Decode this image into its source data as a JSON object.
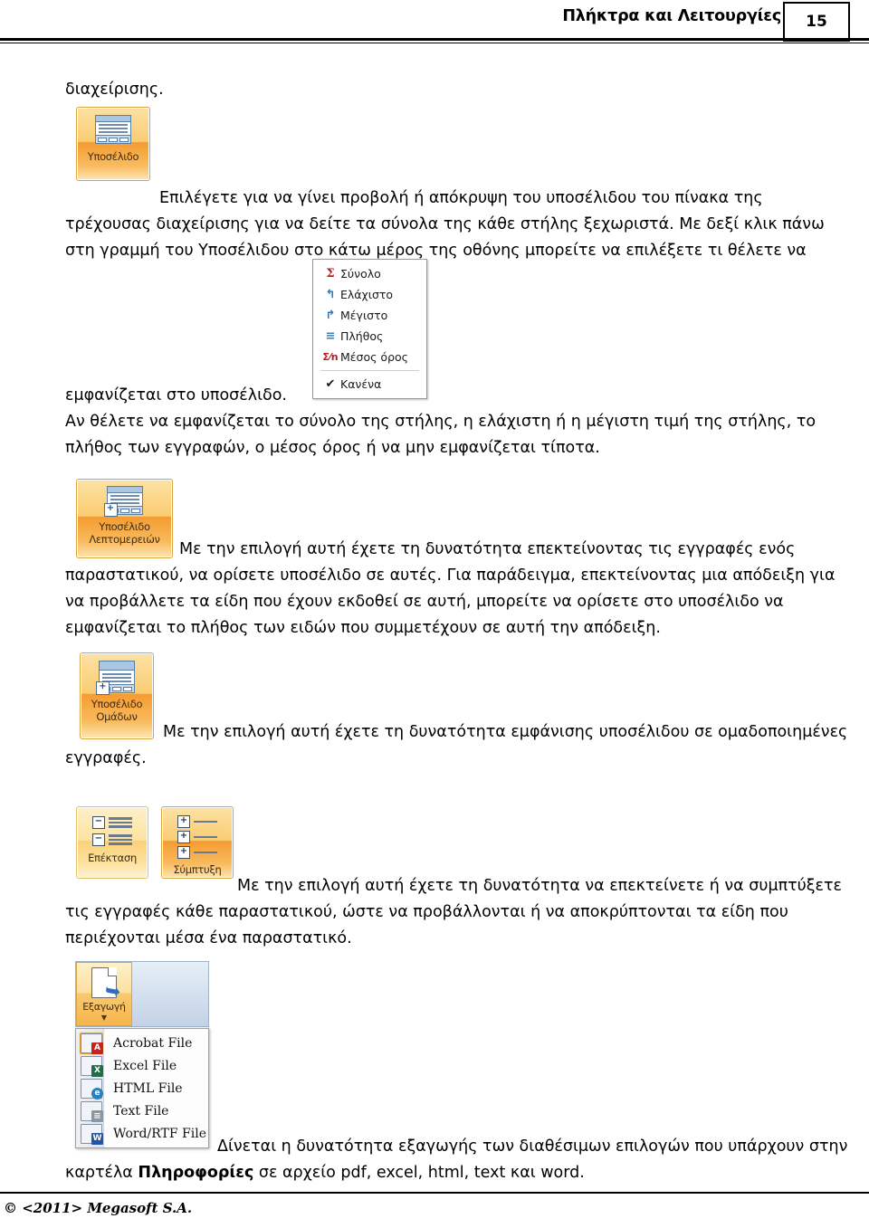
{
  "header": {
    "title": "Πλήκτρα και Λειτουργίες",
    "page_number": "15"
  },
  "footer": {
    "copyright": "© <2011> Megasoft S.A."
  },
  "body": {
    "lead_word": "διαχείρισης.",
    "para1": "Επιλέγετε για να γίνει προβολή ή απόκρυψη του υποσέλιδου του πίνακα της τρέχουσας διαχείρισης για να δείτε τα σύνολα της κάθε στήλης ξεχωριστά. Με δεξί κλικ πάνω στη γραμμή του Υποσέλιδου στο κάτω μέρος της οθόνης μπορείτε να επιλέξετε τι θέλετε να",
    "para2_line1": "εμφανίζεται στο υποσέλιδο.",
    "para2_rest": "Αν θέλετε να εμφανίζεται το σύνολο της στήλης, η ελάχιστη ή η μέγιστη τιμή της στήλης, το πλήθος των εγγραφών, ο μέσος όρος ή να μην εμφανίζεται τίποτα.",
    "para3": "Με την επιλογή αυτή έχετε τη δυνατότητα επεκτείνοντας τις εγγραφές ενός παραστατικού, να ορίσετε υποσέλιδο σε αυτές. Για παράδειγμα, επεκτείνοντας μια απόδειξη για να προβάλλετε τα είδη που έχουν εκδοθεί σε αυτή, μπορείτε να ορίσετε στο υποσέλιδο να εμφανίζεται το πλήθος των ειδών που συμμετέχουν σε αυτή την απόδειξη.",
    "para4": "Με την επιλογή αυτή έχετε τη δυνατότητα εμφάνισης υποσέλιδου σε ομαδοποιημένες εγγραφές.",
    "para5": "Με την επιλογή αυτή έχετε τη δυνατότητα να επεκτείνετε ή να συμπτύξετε τις εγγραφές κάθε παραστατικού, ώστε να προβάλλονται ή να αποκρύπτονται τα είδη που περιέχονται μέσα ένα παραστατικό.",
    "para6_a": "Δίνεται η δυνατότητα εξαγωγής των διαθέσιμων επιλογών που υπάρχουν στην καρτέλα ",
    "para6_bold": "Πληροφορίες",
    "para6_b": " σε αρχείο pdf, excel,  html, text και word."
  },
  "buttons": {
    "footer_button": {
      "label": "Υποσέλιδο",
      "icon": "window-footer-icon"
    },
    "detail_footer_button": {
      "label_line1": "Υποσέλιδο",
      "label_line2": "Λεπτομερειών",
      "icon": "window-footer-plus-icon"
    },
    "group_footer_button": {
      "label_line1": "Υποσέλιδο",
      "label_line2": "Ομάδων",
      "icon": "window-group-footer-icon"
    },
    "expand_button": {
      "label": "Επέκταση",
      "icon": "expand-list-icon",
      "sign": "−"
    },
    "collapse_button": {
      "label": "Σύμπτυξη",
      "icon": "collapse-list-icon",
      "sign": "+"
    },
    "export_button": {
      "label": "Εξαγωγή",
      "icon": "export-document-icon",
      "caret": "▼"
    }
  },
  "stats_menu": {
    "items": [
      {
        "label": "Σύνολο",
        "icon": "sigma-icon",
        "glyph": "Σ",
        "color": "#b02020"
      },
      {
        "label": "Ελάχιστο",
        "icon": "minimum-icon",
        "glyph": "↲",
        "color": "#2f77b5"
      },
      {
        "label": "Μέγιστο",
        "icon": "maximum-icon",
        "glyph": "↳",
        "color": "#2f77b5"
      },
      {
        "label": "Πλήθος",
        "icon": "count-icon",
        "glyph": "≡",
        "color": "#3a7fbf"
      },
      {
        "label": "Μέσος όρος",
        "icon": "average-icon",
        "glyph": "Σ⁄n",
        "color": "#b02020"
      }
    ],
    "none_item": {
      "label": "Κανένα",
      "icon": "check-icon",
      "glyph": "✔",
      "color": "#1a1a1a"
    }
  },
  "export_menu": {
    "items": [
      {
        "label": "Acrobat File",
        "icon": "acrobat-file-icon",
        "badge": "A",
        "badge_color": "#c4231f",
        "selected": true
      },
      {
        "label": "Excel File",
        "icon": "excel-file-icon",
        "badge": "X",
        "badge_color": "#1d7044",
        "selected": false
      },
      {
        "label": "HTML File",
        "icon": "html-file-icon",
        "badge": "e",
        "badge_color": "#2d7fbd",
        "selected": false
      },
      {
        "label": "Text File",
        "icon": "text-file-icon",
        "badge": "≡",
        "badge_color": "#7b8794",
        "selected": false
      },
      {
        "label": "Word/RTF File",
        "icon": "word-file-icon",
        "badge": "W",
        "badge_color": "#2456a5",
        "selected": false
      }
    ]
  }
}
